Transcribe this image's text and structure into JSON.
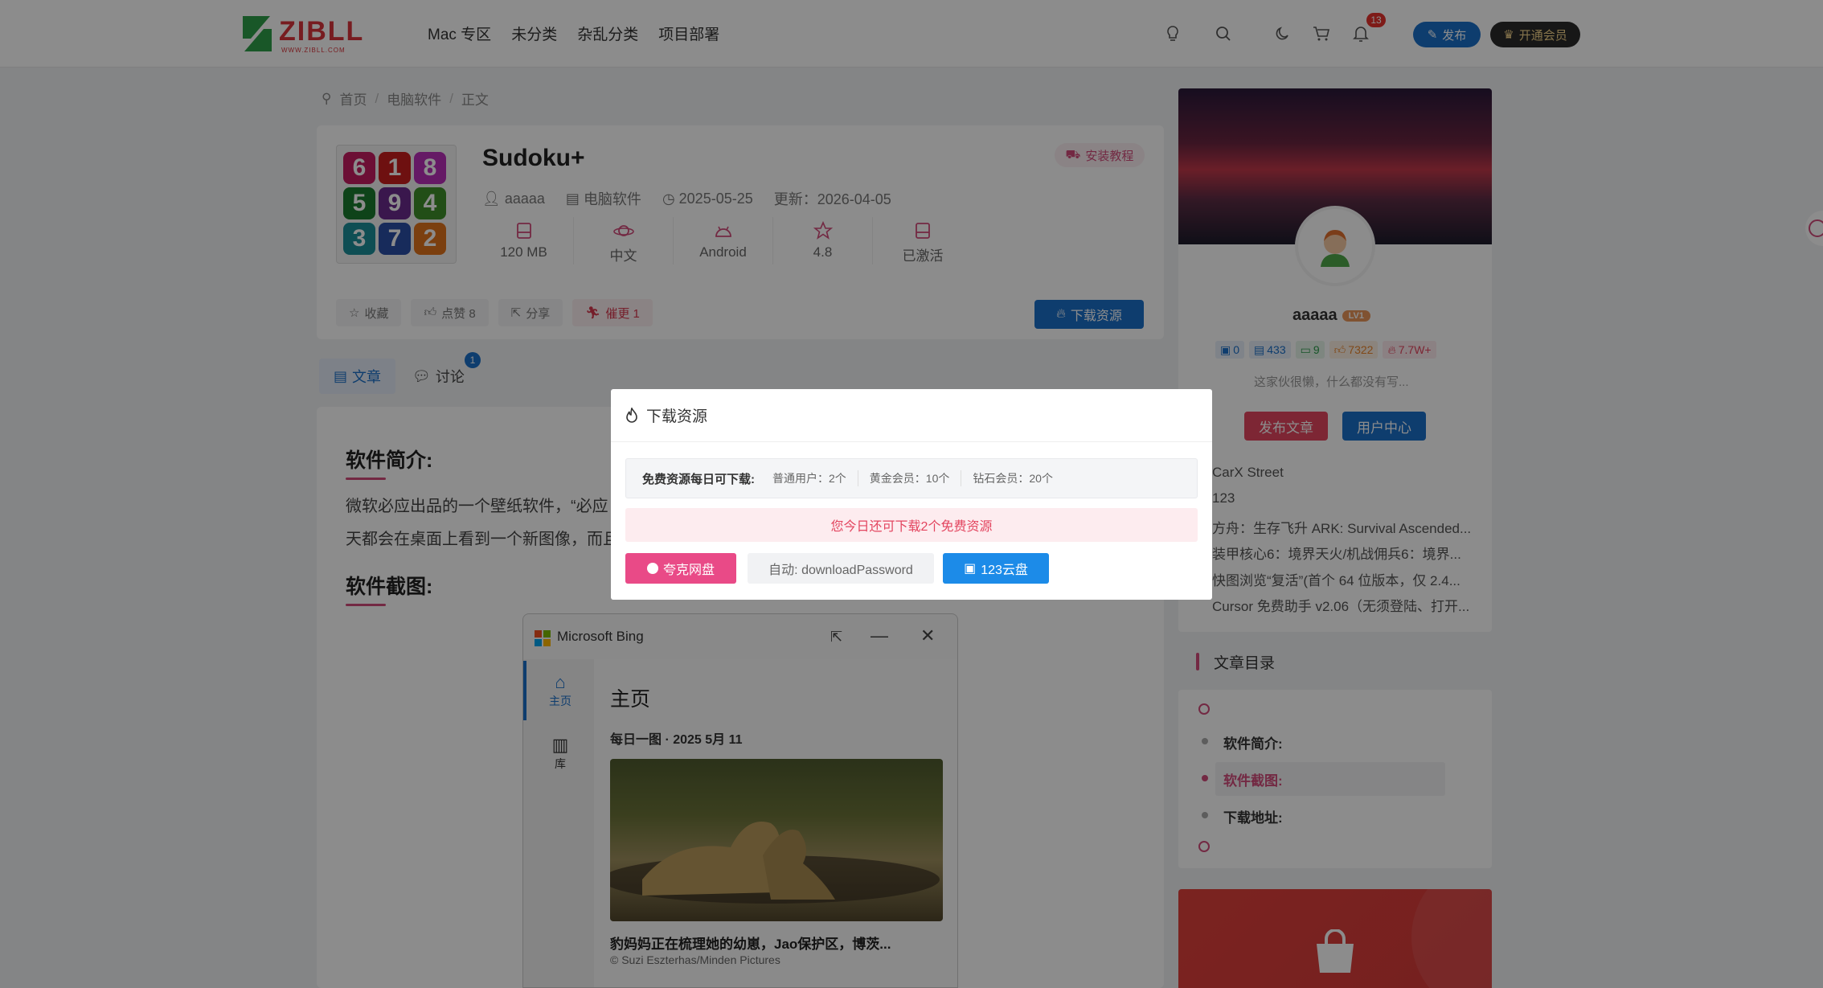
{
  "header": {
    "logo_text": "ZIBLL",
    "logo_sub": "WWW.ZIBLL.COM",
    "nav": [
      "Mac 专区",
      "未分类",
      "杂乱分类",
      "项目部署"
    ],
    "notification_count": "13",
    "publish_label": "发布",
    "vip_label": "开通会员"
  },
  "breadcrumb": [
    "首页",
    "电脑软件",
    "正文"
  ],
  "article": {
    "title": "Sudoku+",
    "install_tag": "安装教程",
    "author": "aaaaa",
    "category": "电脑软件",
    "date": "2025-05-25",
    "updated": "更新：2026-04-05",
    "icon_digits": [
      "6",
      "1",
      "8",
      "5",
      "9",
      "4",
      "3",
      "7",
      "2"
    ],
    "specs": [
      {
        "icon": "disk-icon",
        "value": "120 MB"
      },
      {
        "icon": "planet-icon",
        "value": "中文"
      },
      {
        "icon": "android-icon",
        "value": "Android"
      },
      {
        "icon": "star-icon",
        "value": "4.8"
      },
      {
        "icon": "disk-icon",
        "value": "已激活"
      }
    ],
    "actions": {
      "favorite": "收藏",
      "like": "点赞 8",
      "share": "分享",
      "urge": "催更 1"
    },
    "download_label": "下载资源",
    "tabs": {
      "article": "文章",
      "discuss": "讨论",
      "discuss_count": "1"
    },
    "h_intro": "软件简介:",
    "para1": "微软必应出品的一个壁纸软件，“必应",
    "para2": "天都会在桌面上看到一个新图像，而且",
    "h_screens": "软件截图:"
  },
  "bing": {
    "title": "Microsoft Bing",
    "side_home": "主页",
    "side_lib": "库",
    "main_title": "主页",
    "daily": "每日一图 · 2025 5月 11",
    "caption": "豹妈妈正在梳理她的幼崽，Jao保护区，博茨...",
    "credit": "© Suzi Eszterhas/Minden Pictures"
  },
  "sidebar": {
    "username": "aaaaa",
    "level": "LV1",
    "stats": [
      {
        "icon": "comment-icon",
        "value": "0",
        "color": "#1b6fc8",
        "bg": "#e7eef9"
      },
      {
        "icon": "doc-icon",
        "value": "433",
        "color": "#1b6fc8",
        "bg": "#e7eef9"
      },
      {
        "icon": "chat-icon",
        "value": "9",
        "color": "#2b9a4a",
        "bg": "#e6f5ea"
      },
      {
        "icon": "thumb-icon",
        "value": "7322",
        "color": "#e9852e",
        "bg": "#fdf1e4"
      },
      {
        "icon": "fire-icon",
        "value": "7.7W+",
        "color": "#e3455f",
        "bg": "#fdecef"
      }
    ],
    "bio": "这家伙很懒，什么都没有写...",
    "btn_post": "发布文章",
    "btn_center": "用户中心",
    "list": [
      "CarX Street",
      "123",
      "方舟：生存飞升 ARK: Survival Ascended...",
      "装甲核心6：境界天火/机战佣兵6：境界...",
      "快图浏览“复活”(首个 64 位版本，仅 2.4...",
      "Cursor 免费助手 v2.06（无须登陆、打开..."
    ],
    "toc_title": "文章目录",
    "toc": [
      "软件简介:",
      "软件截图:",
      "下载地址:"
    ]
  },
  "modal": {
    "title": "下载资源",
    "quota_label": "免费资源每日可下载:",
    "quota_items": [
      "普通用户：2个",
      "黄金会员：10个",
      "钻石会员：20个"
    ],
    "remain": "您今日还可下载2个免费资源",
    "btn_quark": "夸克网盘",
    "btn_password": "自动: downloadPassword",
    "btn_123": "123云盘"
  }
}
